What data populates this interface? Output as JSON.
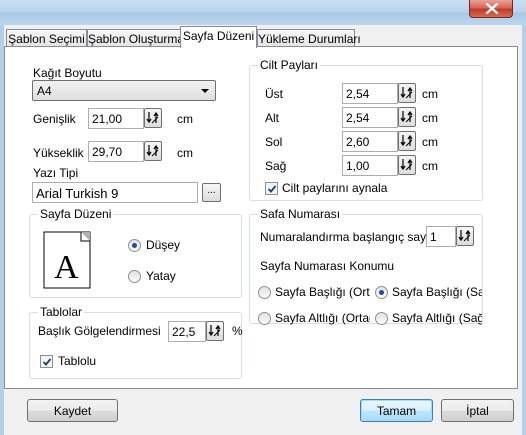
{
  "tabs": [
    {
      "label": "Şablon Seçimi"
    },
    {
      "label": "Şablon Oluşturma"
    },
    {
      "label": "Sayfa Düzeni"
    },
    {
      "label": "Yükleme Durumları"
    }
  ],
  "paper": {
    "size_label": "Kağıt Boyutu",
    "size_value": "A4",
    "width_label": "Genişlik",
    "width_value": "21,00",
    "width_unit": "cm",
    "height_label": "Yükseklik",
    "height_value": "29,70",
    "height_unit": "cm",
    "font_label": "Yazı Tipi",
    "font_value": "Arial Turkish 9",
    "font_button": "..."
  },
  "margins": {
    "title": "Cilt Payları",
    "rows": [
      {
        "label": "Üst",
        "value": "2,54",
        "unit": "cm"
      },
      {
        "label": "Alt",
        "value": "2,54",
        "unit": "cm"
      },
      {
        "label": "Sol",
        "value": "2,60",
        "unit": "cm"
      },
      {
        "label": "Sağ",
        "value": "1,00",
        "unit": "cm"
      }
    ],
    "mirror_label": "Cilt paylarını aynala",
    "mirror_checked": true
  },
  "layout": {
    "title": "Sayfa Düzeni",
    "preview_letter": "A",
    "portrait_label": "Düşey",
    "landscape_label": "Yatay",
    "selected": "portrait"
  },
  "numbering": {
    "title": "Safa Numarası",
    "start_label": "Numaralandırma başlangıç sayfası :",
    "start_value": "1",
    "position_title": "Sayfa Numarası Konumu",
    "options": [
      {
        "label": "Sayfa Başlığı (Ortada)",
        "checked": false
      },
      {
        "label": "Sayfa Başlığı (Sağda)",
        "checked": true
      },
      {
        "label": "Sayfa Altlığı (Ortada)",
        "checked": false
      },
      {
        "label": "Sayfa Altlığı (Sağda)",
        "checked": false
      }
    ]
  },
  "tables": {
    "title": "Tablolar",
    "shading_label": "Başlık Gölgelendirmesi",
    "shading_value": "22,5",
    "shading_unit": "%",
    "bordered_label": "Tablolu",
    "bordered_checked": true
  },
  "buttons": {
    "save": "Kaydet",
    "ok": "Tamam",
    "cancel": "İptal"
  },
  "colors": {
    "titlebar": "#b8d3ec",
    "close_button": "#c23a26",
    "panel": "#ffffff",
    "dialog": "#f0f0f0"
  }
}
